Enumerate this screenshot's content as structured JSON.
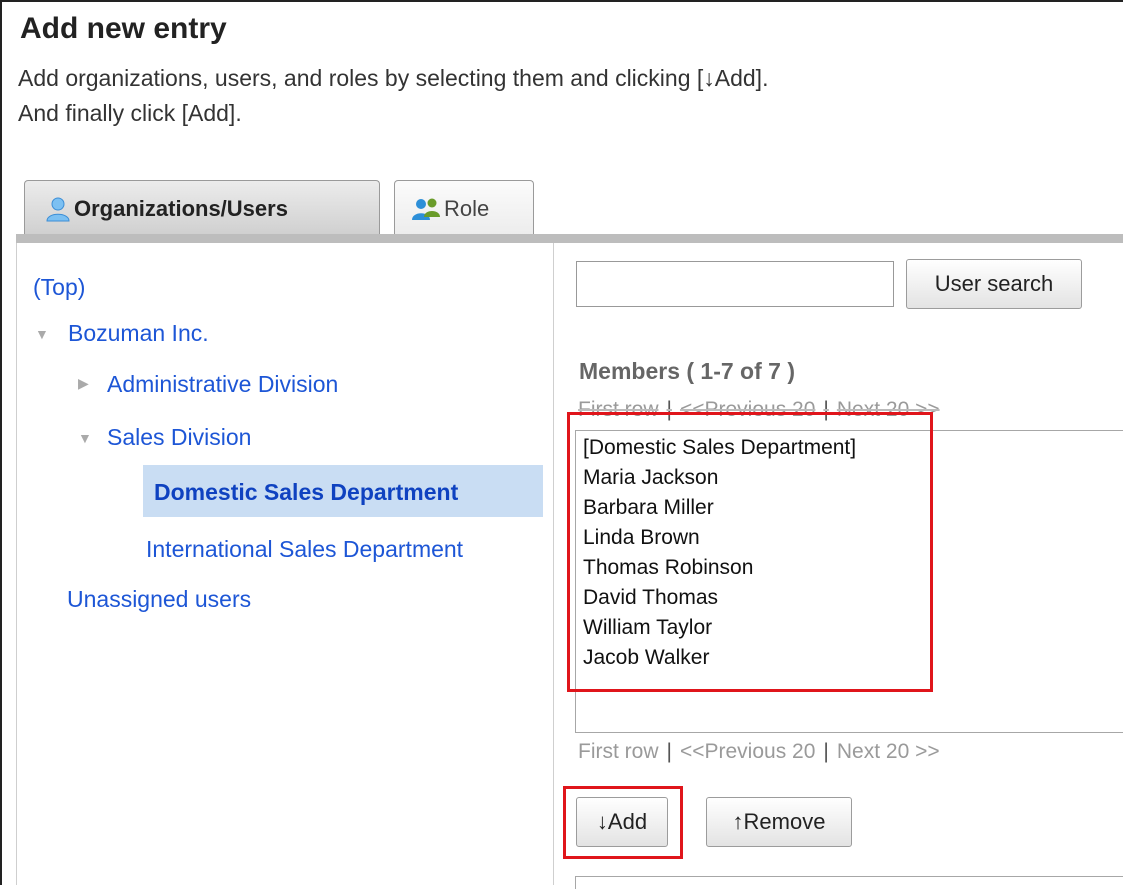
{
  "heading": "Add new entry",
  "instructions": [
    "Add organizations, users, and roles by selecting them and clicking [↓Add].",
    "And finally click [Add]."
  ],
  "tabs": {
    "org_users": "Organizations/Users",
    "role": "Role",
    "active": "org_users"
  },
  "tree": {
    "top": "(Top)",
    "root": "Bozuman Inc.",
    "admin_division": "Administrative Division",
    "sales_division": "Sales Division",
    "domestic_sales": "Domestic Sales Department",
    "international_sales": "International Sales Department",
    "unassigned": "Unassigned users",
    "selected": "domestic_sales"
  },
  "search": {
    "value": "",
    "button": "User search"
  },
  "members": {
    "title": "Members ( 1-7 of 7 )",
    "items": [
      "[Domestic Sales Department]",
      "Maria Jackson",
      "Barbara Miller",
      "Linda Brown",
      "Thomas Robinson",
      "David Thomas",
      "William Taylor",
      "Jacob Walker"
    ]
  },
  "pager": {
    "first": "First row",
    "sep": "|",
    "prev": "<<Previous 20",
    "next": "Next 20 >>"
  },
  "actions": {
    "add": "↓Add",
    "remove": "↑Remove"
  },
  "colors": {
    "link": "#1d56d6",
    "highlight_box": "#e0151b",
    "selected_node_bg": "#c9ddf3"
  }
}
